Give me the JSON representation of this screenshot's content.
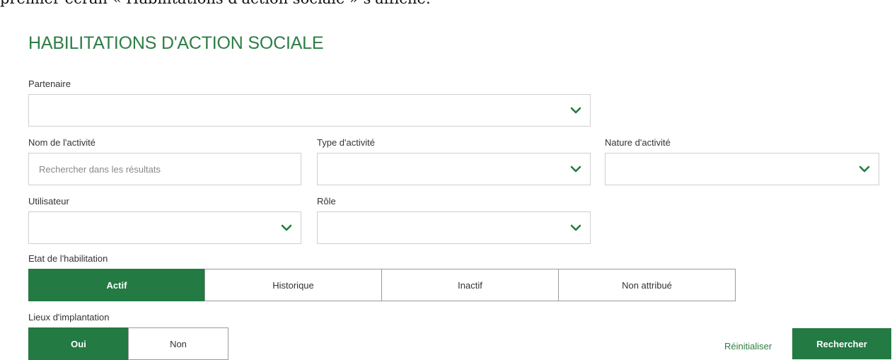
{
  "doc_text": "premier écran « Habilitations d'action sociale » s'affiche.",
  "title": "HABILITATIONS D'ACTION SOCIALE",
  "fields": {
    "partenaire": {
      "label": "Partenaire"
    },
    "nom_activite": {
      "label": "Nom de l'activité",
      "placeholder": "Rechercher dans les résultats"
    },
    "type_activite": {
      "label": "Type d'activité"
    },
    "nature_activite": {
      "label": "Nature d'activité"
    },
    "utilisateur": {
      "label": "Utilisateur"
    },
    "role": {
      "label": "Rôle"
    }
  },
  "etat": {
    "label": "Etat de l'habilitation",
    "options": [
      "Actif",
      "Historique",
      "Inactif",
      "Non attribué"
    ],
    "selected": "Actif"
  },
  "lieux": {
    "label": "Lieux d'implantation",
    "options": [
      "Oui",
      "Non"
    ],
    "selected": "Oui"
  },
  "actions": {
    "reset": "Réinitialiser",
    "search": "Rechercher"
  },
  "colors": {
    "accent": "#237a43",
    "title": "#2e7d46",
    "border": "#cfcfcf"
  },
  "icons": {
    "dropdown": "chevron-down-icon"
  }
}
